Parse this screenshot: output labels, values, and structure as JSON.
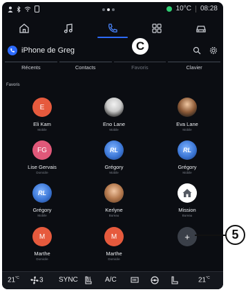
{
  "status_bar": {
    "temperature": "10°C",
    "time": "08:28"
  },
  "app_tabs": [
    {
      "icon": "home-icon"
    },
    {
      "icon": "music-icon"
    },
    {
      "icon": "phone-icon",
      "active": true
    },
    {
      "icon": "apps-grid-icon"
    },
    {
      "icon": "car-icon"
    }
  ],
  "device": {
    "name": "iPhone de Greg"
  },
  "callouts": {
    "c": "C",
    "five": "5"
  },
  "subtabs": [
    {
      "label": "Récents"
    },
    {
      "label": "Contacts"
    },
    {
      "label": "Favoris"
    },
    {
      "label": "Clavier"
    }
  ],
  "section_label": "Favoris",
  "favorites": [
    {
      "name": "Eli Kam",
      "sub": "Mobile",
      "avatar": "E"
    },
    {
      "name": "Eno Lane",
      "sub": "Mobile",
      "avatar": ""
    },
    {
      "name": "Eva Lane",
      "sub": "Mobile",
      "avatar": ""
    },
    {
      "name": "Lise Gervais",
      "sub": "Domicile",
      "avatar": "FG"
    },
    {
      "name": "Grégory",
      "sub": "Mobile",
      "avatar": "RL"
    },
    {
      "name": "Grégory",
      "sub": "Mobile",
      "avatar": "RL"
    },
    {
      "name": "Grégory",
      "sub": "Mobile",
      "avatar": "RL"
    },
    {
      "name": "Kerlyne",
      "sub": "Bureau",
      "avatar": ""
    },
    {
      "name": "Mission",
      "sub": "Bureau",
      "avatar": ""
    },
    {
      "name": "Marthe",
      "sub": "Domicile",
      "avatar": "M"
    },
    {
      "name": "Marthe",
      "sub": "Domicile",
      "avatar": "M"
    }
  ],
  "add_button": "+",
  "climate": {
    "left_temp": "21",
    "left_unit": "°C",
    "fan_level": "3",
    "sync": "SYNC",
    "ac": "A/C",
    "right_temp": "21",
    "right_unit": "°C"
  }
}
